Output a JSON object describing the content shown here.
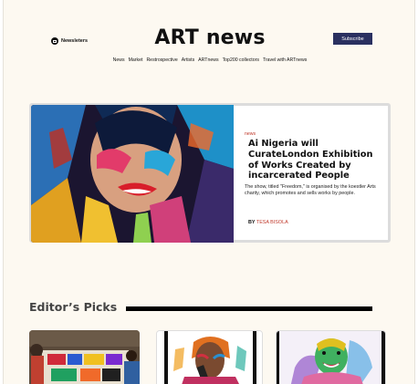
{
  "header": {
    "newsletters_label": "Newsleters",
    "logo": "ART news",
    "subscribe_label": "Subscribe"
  },
  "nav": {
    "items": [
      "News",
      "Market",
      "Restrospective",
      "Artists",
      "ARTnews",
      "Top200 collectors",
      "Travel with ARTnews"
    ]
  },
  "feature": {
    "tag": "news",
    "headline": "Ai Nigeria will CurateLondon Exhibition of Works Created by incarcerated People",
    "summary": "The show, titled \"Freedom,\" is organised by the koestler Arts charity, which promotes and sells works by people.",
    "byline_prefix": "BY",
    "author": "TESA BISOLA"
  },
  "editors_picks": {
    "title": "Editor’s Picks"
  },
  "colors": {
    "background": "#fdf9f1",
    "subscribe_bg": "#2a3060",
    "accent_red": "#c0392b"
  }
}
